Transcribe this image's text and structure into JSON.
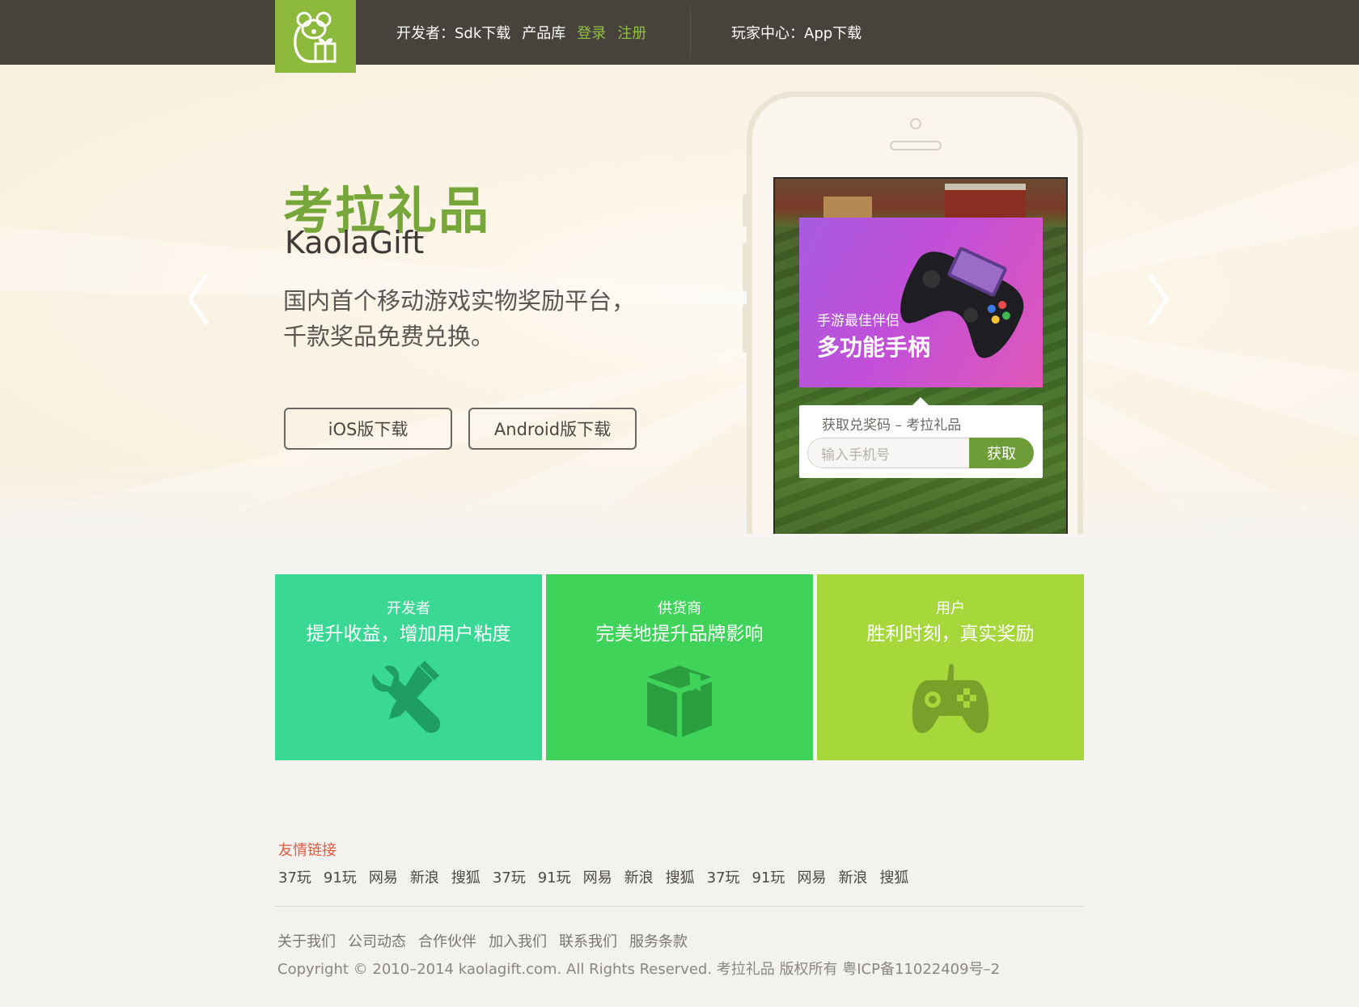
{
  "topbar": {
    "developer_prefix": "开发者：",
    "sdk_download": "Sdk下载",
    "product_library": "产品库",
    "login": "登录",
    "register": "注册",
    "player_prefix": "玩家中心：",
    "app_download": "App下载",
    "logo_icon": "koala-gift-icon",
    "logo_color": "#8cb83b",
    "bar_color": "#48423c"
  },
  "hero": {
    "title": "考拉礼品",
    "title_en": "KaolaGift",
    "desc_line1": "国内首个移动游戏实物奖励平台，",
    "desc_line2": "千款奖品免费兑换。",
    "ios_button": "iOS版下载",
    "android_button": "Android版下载",
    "prev_icon": "chevron-left-icon",
    "next_icon": "chevron-right-icon",
    "title_color": "#77a73a"
  },
  "phone": {
    "promo_subtitle": "手游最佳伴侣",
    "promo_title": "多功能手柄",
    "promo_image_icon": "gamepad-icon",
    "code_title": "获取兑奖码 – 考拉礼品",
    "phone_placeholder": "输入手机号",
    "get_button": "获取"
  },
  "cards": [
    {
      "role": "开发者",
      "tagline": "提升收益，增加用户粘度",
      "icon": "tools-icon",
      "color": "#3ad895"
    },
    {
      "role": "供货商",
      "tagline": "完美地提升品牌影响",
      "icon": "box-icon",
      "color": "#40d35a"
    },
    {
      "role": "用户",
      "tagline": "胜利时刻，真实奖励",
      "icon": "gamepad-icon",
      "color": "#a6d83c"
    }
  ],
  "footer": {
    "links_title": "友情链接",
    "links": [
      "37玩",
      "91玩",
      "网易",
      "新浪",
      "搜狐",
      "37玩",
      "91玩",
      "网易",
      "新浪",
      "搜狐",
      "37玩",
      "91玩",
      "网易",
      "新浪",
      "搜狐"
    ],
    "nav": [
      "关于我们",
      "公司动态",
      "合作伙伴",
      "加入我们",
      "联系我们",
      "服务条款"
    ],
    "copyright": "Copyright © 2010–2014 kaolagift.com. All Rights Reserved. 考拉礼品 版权所有 粤ICP备11022409号–2"
  }
}
